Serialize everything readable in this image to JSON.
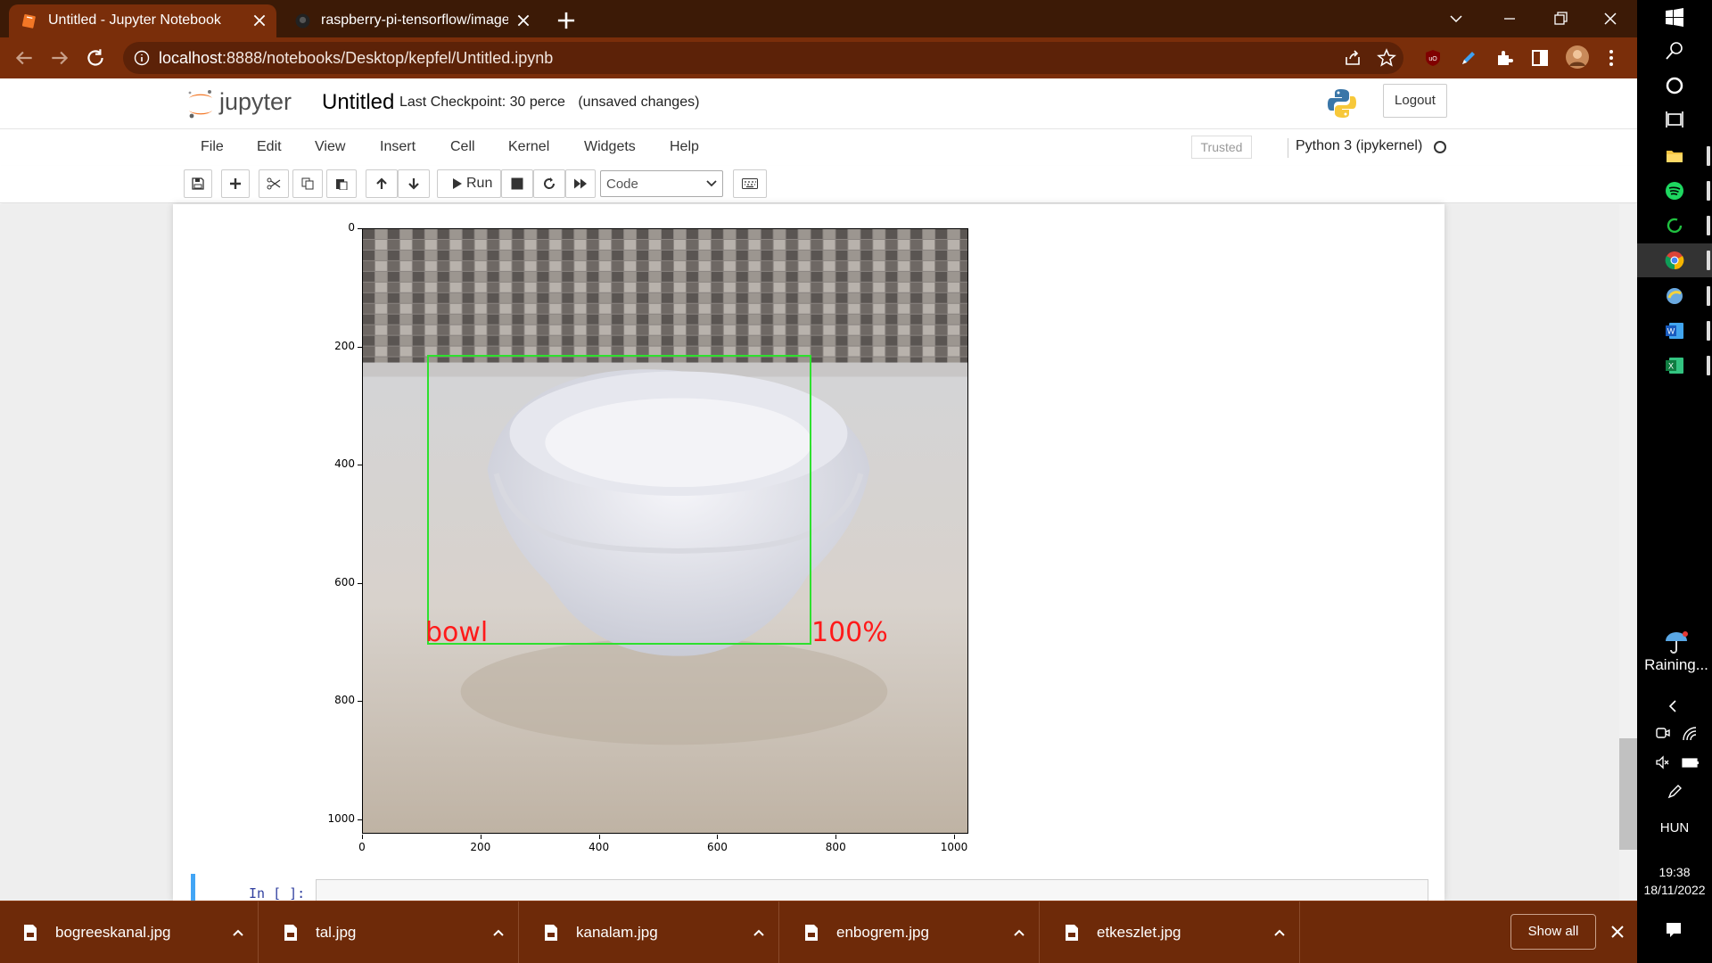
{
  "browser": {
    "tabs": [
      {
        "title": "Untitled - Jupyter Notebook",
        "active": true
      },
      {
        "title": "raspberry-pi-tensorflow/image_d",
        "active": false
      }
    ],
    "url_host": "localhost",
    "url_path": ":8888/notebooks/Desktop/kepfel/Untitled.ipynb",
    "theme_colors": {
      "tabbar": "#3c1a06",
      "toolbar": "#7a2e0a"
    }
  },
  "jupyter": {
    "logo_text": "jupyter",
    "notebook_name": "Untitled",
    "checkpoint": "Last Checkpoint: 30 perce",
    "unsaved": "(unsaved changes)",
    "logout": "Logout",
    "menus": [
      "File",
      "Edit",
      "View",
      "Insert",
      "Cell",
      "Kernel",
      "Widgets",
      "Help"
    ],
    "trusted": "Trusted",
    "kernel": "Python 3 (ipykernel)",
    "toolbar": {
      "run_label": "Run",
      "cell_type": "Code"
    },
    "next_cell_prompt": "In [ ]:"
  },
  "chart_data": {
    "type": "image",
    "xticks": [
      "0",
      "200",
      "400",
      "600",
      "800",
      "1000"
    ],
    "yticks": [
      "0",
      "200",
      "400",
      "600",
      "800",
      "1000"
    ],
    "xlim": [
      0,
      1024
    ],
    "ylim": [
      1024,
      0
    ],
    "detection": {
      "label": "bowl",
      "score": "100%",
      "box_color": "#2ee02e",
      "label_color": "#ff1a1a"
    }
  },
  "downloads": {
    "items": [
      "bogreeskanal.jpg",
      "tal.jpg",
      "kanalam.jpg",
      "enbogrem.jpg",
      "etkeszlet.jpg"
    ],
    "show_all": "Show all"
  },
  "taskbar": {
    "weather": "Raining...",
    "language": "HUN",
    "time": "19:38",
    "date": "18/11/2022"
  }
}
